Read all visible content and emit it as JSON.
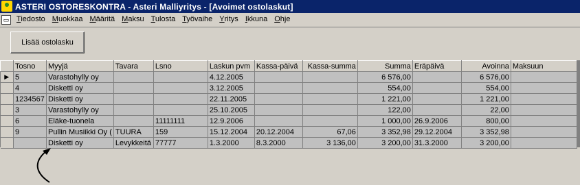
{
  "window": {
    "title": "ASTERI OSTORESKONTRA - Asteri Malliyritys - [Avoimet ostolaskut]"
  },
  "menu": [
    "Tiedosto",
    "Muokkaa",
    "Määritä",
    "Maksu",
    "Tulosta",
    "Työvaihe",
    "Yritys",
    "Ikkuna",
    "Ohje"
  ],
  "toolbar": {
    "add_invoice_label": "Lisää ostolasku"
  },
  "table": {
    "headers": [
      "Tosno",
      "Myyjä",
      "Tavara",
      "Lsno",
      "Laskun pvm",
      "Kassa-päivä",
      "Kassa-summa",
      "Summa",
      "Eräpäivä",
      "Avoinna",
      "Maksuun"
    ],
    "rows": [
      [
        "5",
        "Varastohylly oy",
        "",
        "",
        "4.12.2005",
        "",
        "",
        "6 576,00",
        "",
        "6 576,00",
        ""
      ],
      [
        "4",
        "Disketti oy",
        "",
        "",
        "3.12.2005",
        "",
        "",
        "554,00",
        "",
        "554,00",
        ""
      ],
      [
        "1234567",
        "Disketti oy",
        "",
        "",
        "22.11.2005",
        "",
        "",
        "1 221,00",
        "",
        "1 221,00",
        ""
      ],
      [
        "3",
        "Varastohylly oy",
        "",
        "",
        "25.10.2005",
        "",
        "",
        "122,00",
        "",
        "22,00",
        ""
      ],
      [
        "6",
        "Eläke-tuonela",
        "",
        "11111111",
        "12.9.2006",
        "",
        "",
        "1 000,00",
        "26.9.2006",
        "800,00",
        ""
      ],
      [
        "9",
        "Pullin Musiikki Oy (",
        "TUURA",
        "159",
        "15.12.2004",
        "20.12.2004",
        "67,06",
        "3 352,98",
        "29.12.2004",
        "3 352,98",
        ""
      ],
      [
        "",
        "Disketti oy",
        "Levykkeitä",
        "77777",
        "1.3.2000",
        "8.3.2000",
        "3 136,00",
        "3 200,00",
        "31.3.2000",
        "3 200,00",
        ""
      ]
    ]
  }
}
